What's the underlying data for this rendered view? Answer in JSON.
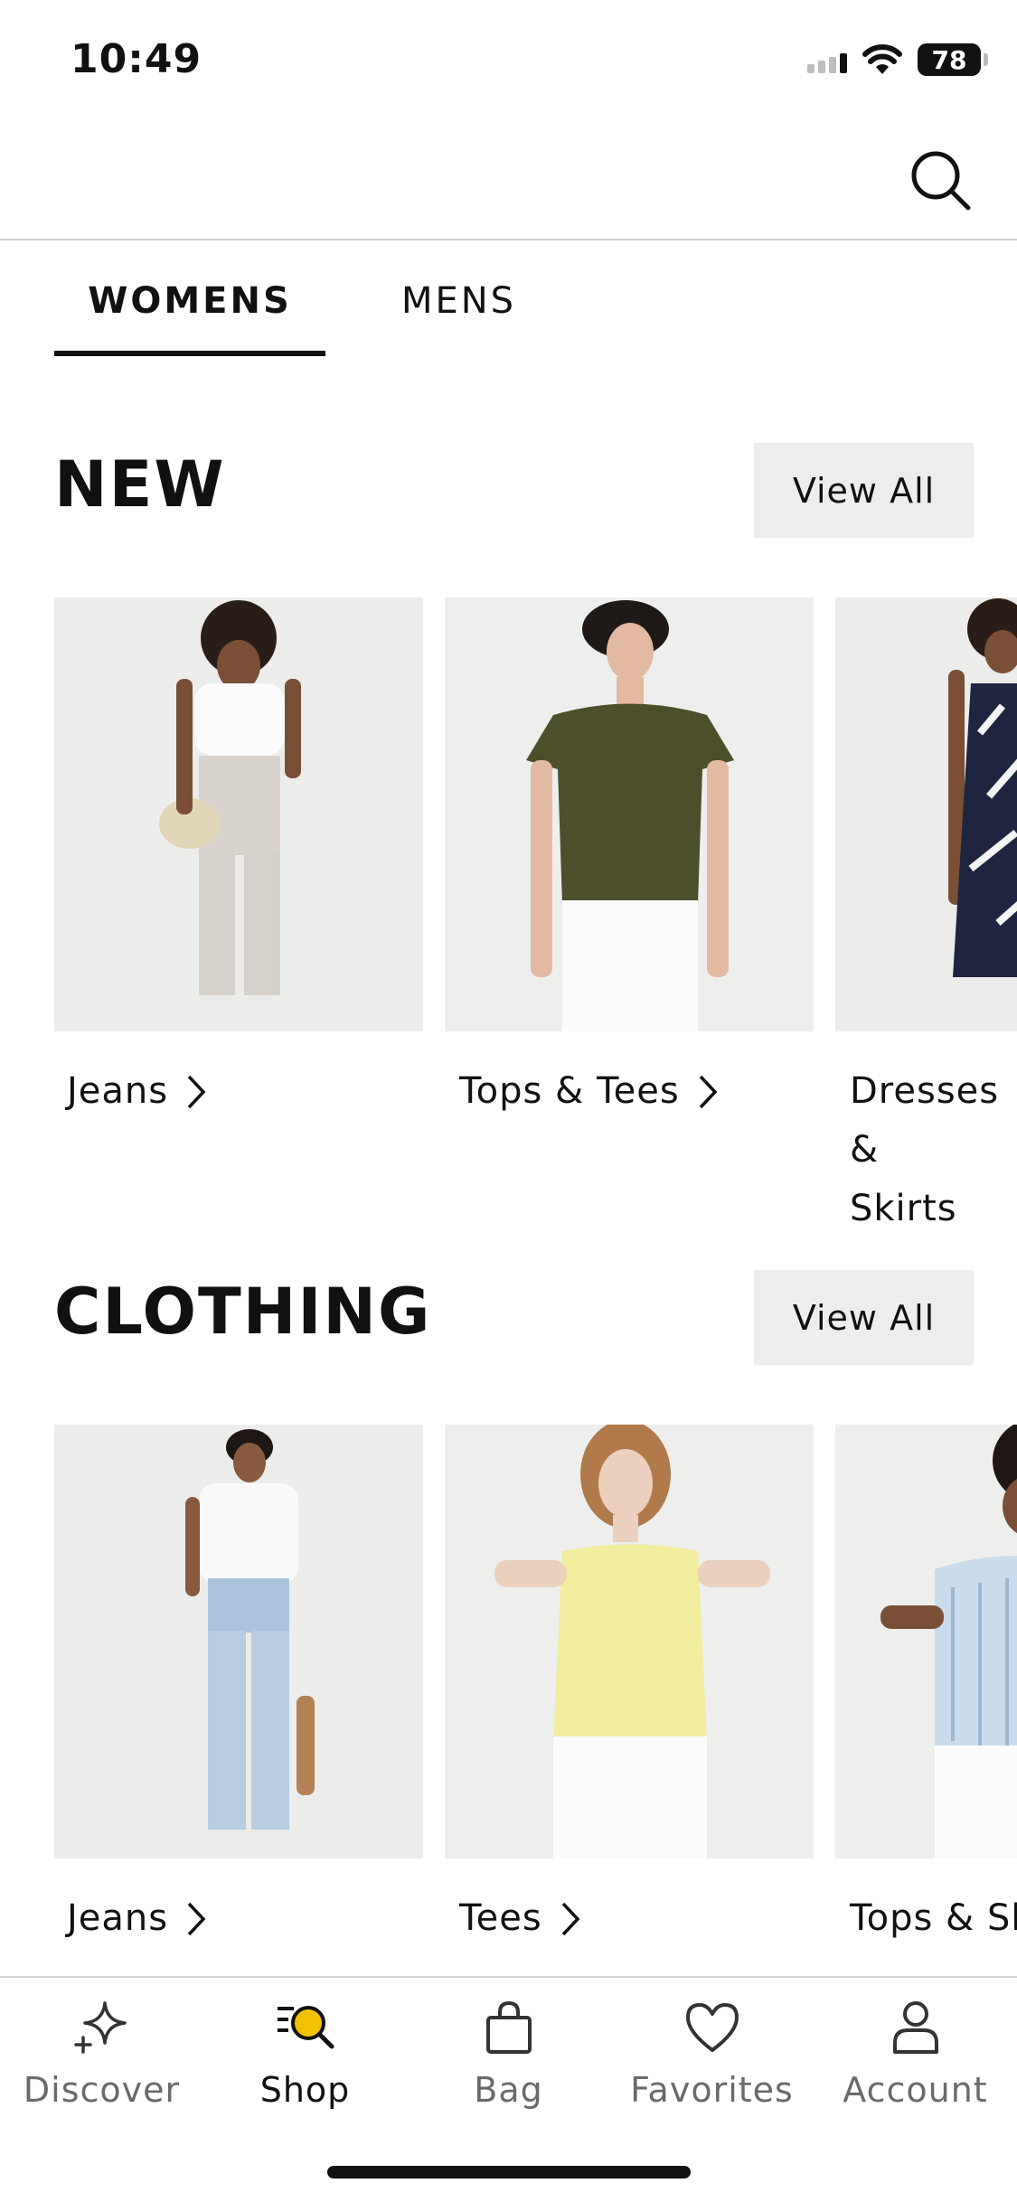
{
  "status_bar": {
    "time": "10:49",
    "battery": "78"
  },
  "tabs": [
    {
      "label": "WOMENS",
      "active": true
    },
    {
      "label": "MENS",
      "active": false
    }
  ],
  "sections": [
    {
      "title": "NEW",
      "view_all": "View All",
      "items": [
        {
          "label": "Jeans"
        },
        {
          "label": "Tops & Tees"
        },
        {
          "label": "Dresses & Skirts",
          "line1": "Dresses &",
          "line2": "Skirts"
        }
      ]
    },
    {
      "title": "CLOTHING",
      "view_all": "View All",
      "items": [
        {
          "label": "Jeans"
        },
        {
          "label": "Tees"
        },
        {
          "label": "Tops & Sh"
        }
      ]
    }
  ],
  "bottom_nav": [
    {
      "label": "Discover",
      "icon": "sparkle-icon",
      "active": false
    },
    {
      "label": "Shop",
      "icon": "shop-search-icon",
      "active": true
    },
    {
      "label": "Bag",
      "icon": "bag-icon",
      "active": false
    },
    {
      "label": "Favorites",
      "icon": "heart-icon",
      "active": false
    },
    {
      "label": "Account",
      "icon": "person-icon",
      "active": false
    }
  ],
  "colors": {
    "accent": "#f2c200",
    "text": "#111111",
    "muted": "#6a6a6a",
    "button_bg": "#ededed"
  }
}
